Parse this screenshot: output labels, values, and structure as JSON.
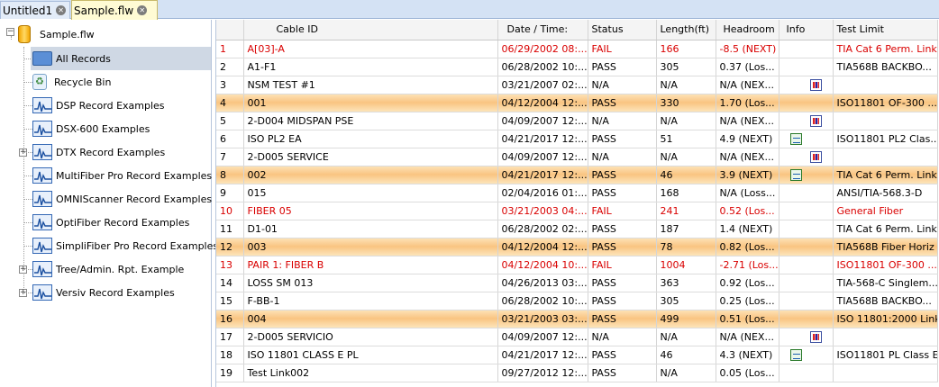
{
  "tabs": [
    {
      "label": "Untitled1",
      "active": false
    },
    {
      "label": "Sample.flw",
      "active": true
    }
  ],
  "tree": {
    "root": "Sample.flw",
    "items": [
      {
        "label": "All Records",
        "icon": "folder-icon",
        "selected": true,
        "expandable": false
      },
      {
        "label": "Recycle Bin",
        "icon": "recycle-bin-icon",
        "selected": false,
        "expandable": false
      },
      {
        "label": "DSP Record Examples",
        "icon": "record-folder-icon",
        "selected": false,
        "expandable": false
      },
      {
        "label": "DSX-600 Examples",
        "icon": "record-folder-icon",
        "selected": false,
        "expandable": false
      },
      {
        "label": "DTX Record Examples",
        "icon": "record-folder-icon",
        "selected": false,
        "expandable": true
      },
      {
        "label": "MultiFiber Pro Record Examples",
        "icon": "record-folder-icon",
        "selected": false,
        "expandable": false
      },
      {
        "label": "OMNIScanner Record Examples",
        "icon": "record-folder-icon",
        "selected": false,
        "expandable": false
      },
      {
        "label": "OptiFiber Record Examples",
        "icon": "record-folder-icon",
        "selected": false,
        "expandable": false
      },
      {
        "label": "SimpliFiber Pro Record Examples",
        "icon": "record-folder-icon",
        "selected": false,
        "expandable": false
      },
      {
        "label": "Tree/Admin. Rpt. Example",
        "icon": "record-folder-icon",
        "selected": false,
        "expandable": true
      },
      {
        "label": "Versiv Record Examples",
        "icon": "record-folder-icon",
        "selected": false,
        "expandable": true
      }
    ]
  },
  "table": {
    "columns": [
      "",
      "Cable ID",
      "Date / Time:",
      "Status",
      "Length(ft)",
      "Headroom",
      "Info",
      "Test Limit"
    ],
    "rows": [
      {
        "n": "1",
        "id": "A[03]-A",
        "date": "06/29/2002  08:...",
        "status": "FAIL",
        "length": "166",
        "headroom": "-8.5 (NEXT)",
        "info": "",
        "limit": "TIA Cat 6  Perm. Link",
        "style": "fail"
      },
      {
        "n": "2",
        "id": "A1-F1",
        "date": "06/28/2002  10:...",
        "status": "PASS",
        "length": "305",
        "headroom": "0.37 (Los...",
        "info": "",
        "limit": "TIA568B BACKBO...",
        "style": ""
      },
      {
        "n": "3",
        "id": "NSM TEST #1",
        "date": "03/21/2007  02:...",
        "status": "N/A",
        "length": "N/A",
        "headroom": "N/A (NEX...",
        "info": "net-icon",
        "limit": "",
        "style": ""
      },
      {
        "n": "4",
        "id": "001",
        "date": "04/12/2004  12:...",
        "status": "PASS",
        "length": "330",
        "headroom": "1.70 (Los...",
        "info": "",
        "limit": "ISO11801 OF-300 ...",
        "style": "hl"
      },
      {
        "n": "5",
        "id": "2-D004 MIDSPAN PSE",
        "date": "04/09/2007  12:...",
        "status": "N/A",
        "length": "N/A",
        "headroom": "N/A (NEX...",
        "info": "net-icon",
        "limit": "",
        "style": ""
      },
      {
        "n": "6",
        "id": "ISO PL2 EA",
        "date": "04/21/2017  12:...",
        "status": "PASS",
        "length": "51",
        "headroom": "4.9 (NEXT)",
        "info": "wave-icon",
        "limit": "ISO11801 PL2 Clas...",
        "style": ""
      },
      {
        "n": "7",
        "id": "2-D005 SERVICE",
        "date": "04/09/2007  12:...",
        "status": "N/A",
        "length": "N/A",
        "headroom": "N/A (NEX...",
        "info": "net-icon",
        "limit": "",
        "style": ""
      },
      {
        "n": "8",
        "id": "002",
        "date": "04/21/2017  12:...",
        "status": "PASS",
        "length": "46",
        "headroom": "3.9 (NEXT)",
        "info": "wave-icon",
        "limit": "TIA Cat 6  Perm. Link",
        "style": "hl"
      },
      {
        "n": "9",
        "id": "015",
        "date": "02/04/2016  01:...",
        "status": "PASS",
        "length": "168",
        "headroom": "N/A (Loss...",
        "info": "",
        "limit": "ANSI/TIA-568.3-D",
        "style": ""
      },
      {
        "n": "10",
        "id": "FIBER 05",
        "date": "03/21/2003  04:...",
        "status": "FAIL",
        "length": "241",
        "headroom": "0.52 (Los...",
        "info": "",
        "limit": "General Fiber",
        "style": "fail"
      },
      {
        "n": "11",
        "id": "D1-01",
        "date": "06/28/2002  02:...",
        "status": "PASS",
        "length": "187",
        "headroom": "1.4 (NEXT)",
        "info": "",
        "limit": "TIA Cat 6  Perm. Link",
        "style": ""
      },
      {
        "n": "12",
        "id": "003",
        "date": "04/12/2004  12:...",
        "status": "PASS",
        "length": "78",
        "headroom": "0.82 (Los...",
        "info": "",
        "limit": "TIA568B Fiber Horiz",
        "style": "hl"
      },
      {
        "n": "13",
        "id": "PAIR 1: FIBER B",
        "date": "04/12/2004  10:...",
        "status": "FAIL",
        "length": "1004",
        "headroom": "-2.71 (Los...",
        "info": "",
        "limit": "ISO11801 OF-300 ...",
        "style": "fail"
      },
      {
        "n": "14",
        "id": "LOSS SM 013",
        "date": "04/26/2013  03:...",
        "status": "PASS",
        "length": "363",
        "headroom": "0.92 (Los...",
        "info": "",
        "limit": "TIA-568-C Singlem...",
        "style": ""
      },
      {
        "n": "15",
        "id": "F-BB-1",
        "date": "06/28/2002  10:...",
        "status": "PASS",
        "length": "305",
        "headroom": "0.25 (Los...",
        "info": "",
        "limit": "TIA568B BACKBO...",
        "style": ""
      },
      {
        "n": "16",
        "id": "004",
        "date": "03/21/2003  03:...",
        "status": "PASS",
        "length": "499",
        "headroom": "0.51 (Los...",
        "info": "",
        "limit": "ISO 11801:2000 Link",
        "style": "hl"
      },
      {
        "n": "17",
        "id": "2-D005 SERVICIO",
        "date": "04/09/2007  12:...",
        "status": "N/A",
        "length": "N/A",
        "headroom": "N/A (NEX...",
        "info": "net-icon",
        "limit": "",
        "style": ""
      },
      {
        "n": "18",
        "id": "ISO 11801 CLASS E PL",
        "date": "04/21/2017  12:...",
        "status": "PASS",
        "length": "46",
        "headroom": "4.3 (NEXT)",
        "info": "wave-icon",
        "limit": "ISO11801 PL Class E",
        "style": ""
      },
      {
        "n": "19",
        "id": "Test Link002",
        "date": "09/27/2012  12:...",
        "status": "PASS",
        "length": "N/A",
        "headroom": "0.05 (Los...",
        "info": "",
        "limit": "",
        "style": ""
      }
    ]
  }
}
